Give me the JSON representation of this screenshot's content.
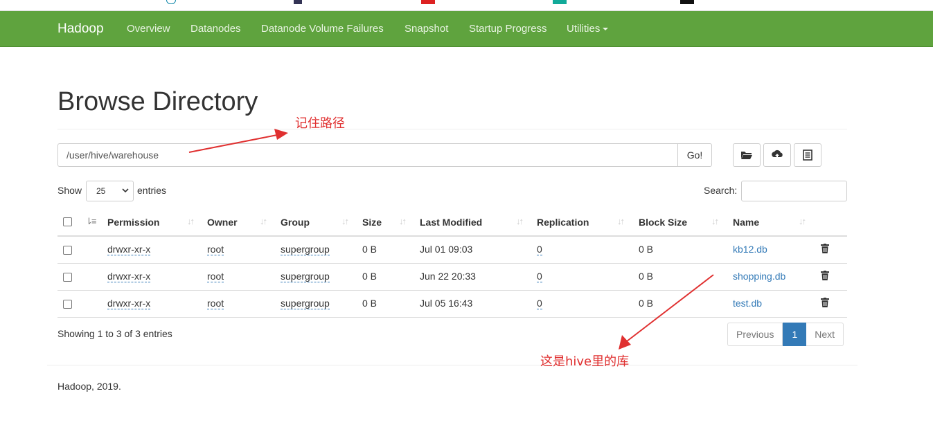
{
  "colors": {
    "navbar": "#5fa33e",
    "link": "#337ab7",
    "annotation": "#e03030"
  },
  "navbar": {
    "brand": "Hadoop",
    "items": [
      "Overview",
      "Datanodes",
      "Datanode Volume Failures",
      "Snapshot",
      "Startup Progress",
      "Utilities"
    ]
  },
  "page": {
    "title": "Browse Directory",
    "path_value": "/user/hive/warehouse",
    "go_label": "Go!",
    "toolbar_icons": [
      "folder-open-icon",
      "cloud-upload-icon",
      "list-icon"
    ]
  },
  "controls": {
    "show_label": "Show",
    "entries_value": "25",
    "entries_label": "entries",
    "search_label": "Search:"
  },
  "table": {
    "headers": [
      "Permission",
      "Owner",
      "Group",
      "Size",
      "Last Modified",
      "Replication",
      "Block Size",
      "Name"
    ],
    "rows": [
      {
        "permission": "drwxr-xr-x",
        "owner": "root",
        "group": "supergroup",
        "size": "0 B",
        "modified": "Jul 01 09:03",
        "replication": "0",
        "block_size": "0 B",
        "name": "kb12.db"
      },
      {
        "permission": "drwxr-xr-x",
        "owner": "root",
        "group": "supergroup",
        "size": "0 B",
        "modified": "Jun 22 20:33",
        "replication": "0",
        "block_size": "0 B",
        "name": "shopping.db"
      },
      {
        "permission": "drwxr-xr-x",
        "owner": "root",
        "group": "supergroup",
        "size": "0 B",
        "modified": "Jul 05 16:43",
        "replication": "0",
        "block_size": "0 B",
        "name": "test.db"
      }
    ]
  },
  "info_text": "Showing 1 to 3 of 3 entries",
  "pagination": {
    "previous": "Previous",
    "current": "1",
    "next": "Next"
  },
  "footer": "Hadoop, 2019.",
  "annotations": {
    "path_note": "记住路径",
    "db_note": "这是hive里的库"
  }
}
